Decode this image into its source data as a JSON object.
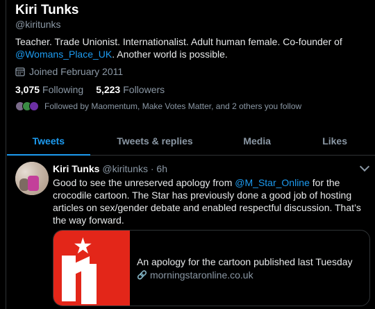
{
  "profile": {
    "name": "Kiri Tunks",
    "handle": "@kiritunks",
    "bio_before": "Teacher. Trade Unionist. Internationalist. Adult human female. Co-founder of ",
    "bio_link": "@Womans_Place_UK",
    "bio_after": ". Another world is possible.",
    "joined": "Joined February 2011",
    "following_count": "3,075",
    "following_label": "Following",
    "followers_count": "5,223",
    "followers_label": "Followers",
    "followed_by": "Followed by Maomentum, Make Votes Matter, and 2 others you follow"
  },
  "tabs": [
    "Tweets",
    "Tweets & replies",
    "Media",
    "Likes"
  ],
  "active_tab": "Tweets",
  "tweet": {
    "name": "Kiri Tunks",
    "meta": "@kiritunks · 6h",
    "text_before": "Good to see the unreserved apology from ",
    "text_link": "@M_Star_Online",
    "text_after": " for the crocodile cartoon. The Star has previously done a good job of hosting articles on sex/gender debate and enabled respectful discussion. That’s the way forward.",
    "card_title": "An apology for the cartoon published last Tuesday",
    "card_domain": "morningstaronline.co.uk"
  },
  "colors": {
    "accent": "#1d9bf0",
    "background": "#000000",
    "card_image": "#e32619"
  },
  "icons": [
    "calendar-icon",
    "chevron-down-icon",
    "link-icon"
  ]
}
